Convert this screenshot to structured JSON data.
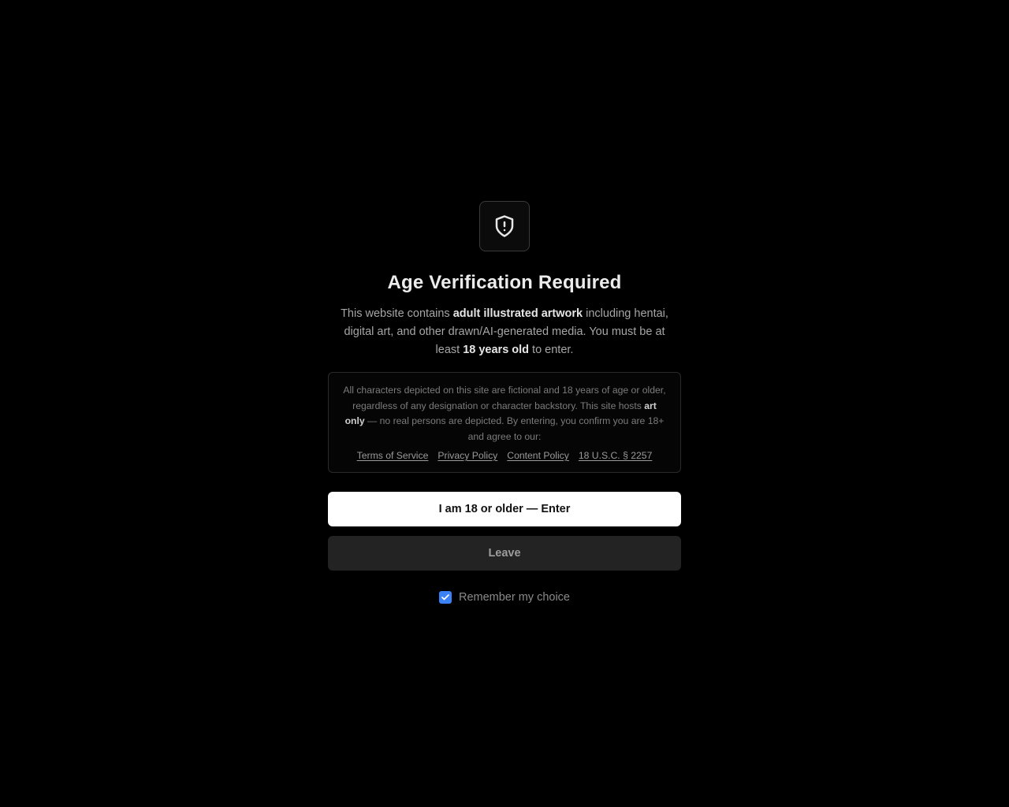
{
  "dialog": {
    "icon": "shield-alert-icon",
    "title": "Age Verification Required",
    "intro": {
      "t1": "This website contains ",
      "b1": "adult illustrated artwork",
      "t2": " including hentai, digital art, and other drawn/AI-generated media. You must be at least ",
      "b2": "18 years old",
      "t3": " to enter."
    },
    "notice": {
      "t1": "All characters depicted on this site are fictional and 18 years of age or older, regardless of any designation or character backstory. This site hosts ",
      "b1": "art only",
      "t2": " — no real persons are depicted. By entering, you confirm you are 18+ and agree to our:"
    },
    "links": [
      "Terms of Service",
      "Privacy Policy",
      "Content Policy",
      "18 U.S.C. § 2257"
    ],
    "enter_label": "I am 18 or older — Enter",
    "leave_label": "Leave",
    "remember_label": "Remember my choice",
    "remember_checked": true
  },
  "colors": {
    "background": "#000000",
    "enter_button_bg": "#ffffff",
    "leave_button_bg": "#232323",
    "checkbox_accent": "#3b82f6"
  }
}
